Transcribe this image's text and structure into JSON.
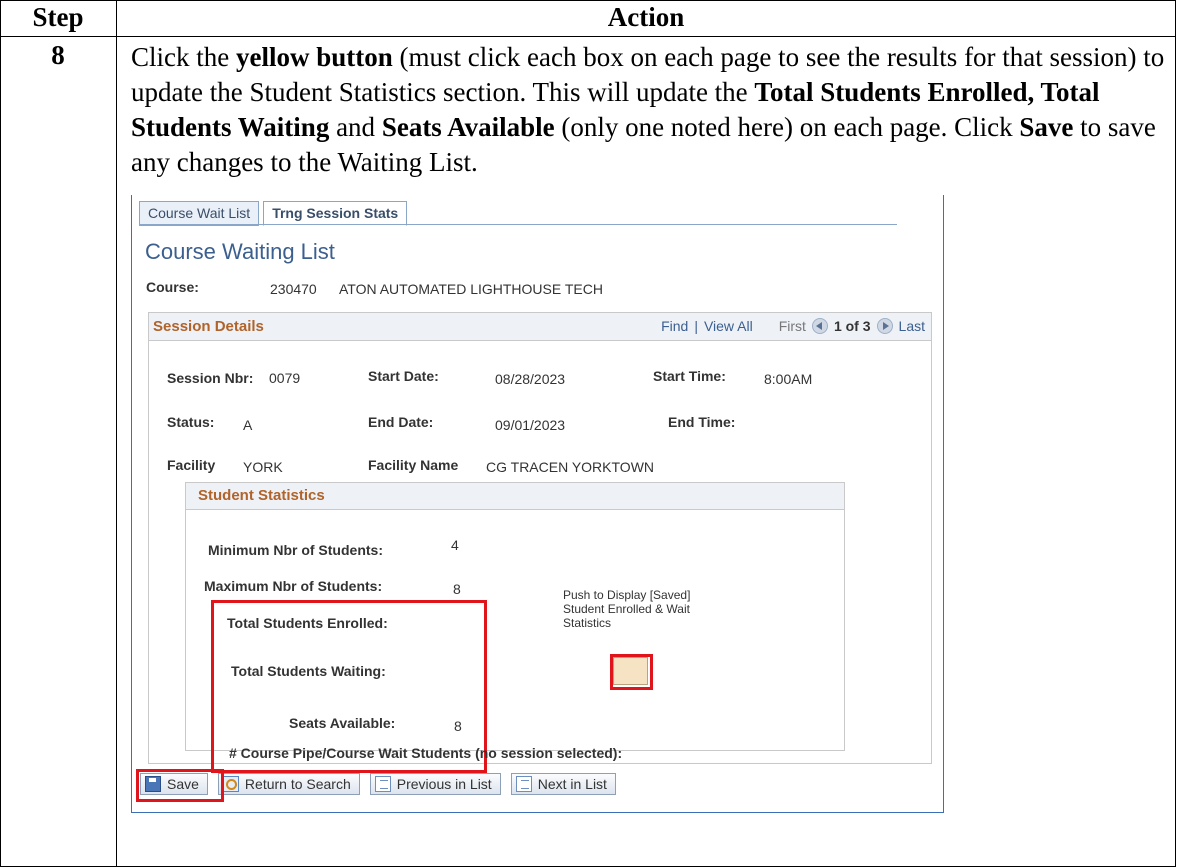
{
  "doc": {
    "col_step": "Step",
    "col_action": "Action",
    "step_number": "8",
    "instruction": {
      "p1": "Click the ",
      "b1": "yellow button",
      "p2": " (must click each box on each page to see the results for that session) to update the Student Statistics section. This will update the ",
      "b2": "Total Students Enrolled, Total Students Waiting",
      "p3": " and ",
      "b3": "Seats Available",
      "p4": " (only one noted here) on each page. Click ",
      "b4": "Save",
      "p5": " to save any changes to the Waiting List."
    }
  },
  "screen": {
    "tabs": [
      "Course Wait List",
      "Trng Session Stats"
    ],
    "page_title": "Course Waiting List",
    "course_label": "Course:",
    "course_id": "230470",
    "course_name": "ATON AUTOMATED LIGHTHOUSE TECH",
    "session": {
      "title": "Session Details",
      "find": "Find",
      "sep": "|",
      "view_all": "View All",
      "first": "First",
      "position": "1 of 3",
      "last": "Last",
      "nbr_label": "Session Nbr:",
      "nbr_value": "0079",
      "start_date_label": "Start Date:",
      "start_date_value": "08/28/2023",
      "start_time_label": "Start Time:",
      "start_time_value": "8:00AM",
      "status_label": "Status:",
      "status_value": "A",
      "end_date_label": "End Date:",
      "end_date_value": "09/01/2023",
      "end_time_label": "End Time:",
      "facility_label": "Facility",
      "facility_value": "YORK",
      "facility_name_label": "Facility Name",
      "facility_name_value": "CG TRACEN YORKTOWN"
    },
    "stats": {
      "title": "Student Statistics",
      "min_label": "Minimum Nbr of Students:",
      "min_value": "4",
      "max_label": "Maximum Nbr of Students:",
      "max_value": "8",
      "enrolled_label": "Total Students Enrolled:",
      "waiting_label": "Total Students Waiting:",
      "seats_label": "Seats Available:",
      "seats_value": "8",
      "pipe_label": "# Course Pipe/Course Wait Students (no session selected):",
      "push_text": "Push to Display [Saved] Student Enrolled & Wait Statistics"
    },
    "buttons": {
      "save": "Save",
      "return": "Return to Search",
      "previous": "Previous in List",
      "next": "Next in List"
    },
    "colors": {
      "highlight": "#e0141b",
      "yellow_button": "#f6e3c4",
      "section_title": "#b0632a",
      "link": "#3b5f8f"
    }
  }
}
